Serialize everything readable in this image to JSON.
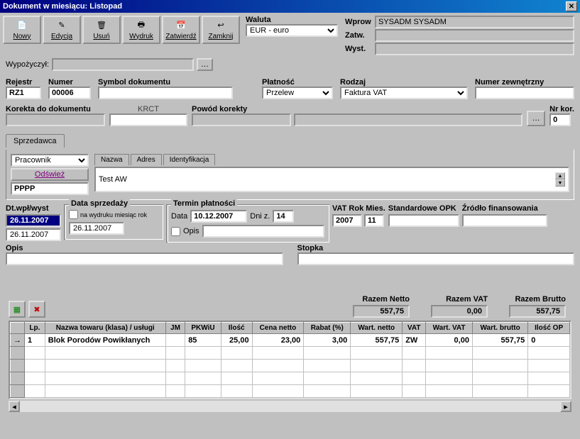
{
  "title": "Dokument w miesiącu: Listopad",
  "toolbar": {
    "nowy": "Nowy",
    "edycja": "Edycja",
    "usun": "Usuń",
    "wydruk": "Wydruk",
    "zatwierdz": "Zatwierdź",
    "zamknij": "Zamknij"
  },
  "header": {
    "waluta_lbl": "Waluta",
    "waluta_val": "EUR - euro",
    "wprow_lbl": "Wprow",
    "wprow_val": "SYSADM SYSADM",
    "zatw_lbl": "Zatw.",
    "zatw_val": "",
    "wyst_lbl": "Wyst.",
    "wyst_val": "",
    "wypozyczyl_lbl": "Wypożyczył:",
    "wypozyczyl_val": ""
  },
  "doc": {
    "rejestr_lbl": "Rejestr",
    "rejestr_val": "RZ1",
    "numer_lbl": "Numer",
    "numer_val": "00006",
    "symbol_lbl": "Symbol dokumentu",
    "symbol_val": "",
    "platnosc_lbl": "Płatność",
    "platnosc_val": "Przelew",
    "rodzaj_lbl": "Rodzaj",
    "rodzaj_val": "Faktura VAT",
    "numer_zew_lbl": "Numer zewnętrzny",
    "numer_zew_val": "",
    "korekta_lbl": "Korekta do dokumentu",
    "korekta_mid": "KRCT",
    "powod_lbl": "Powód korekty",
    "nrkor_lbl": "Nr kor.",
    "nrkor_val": "0"
  },
  "sprzedawca": {
    "tab": "Sprzedawca",
    "typ_val": "Pracownik",
    "sub_nazwa": "Nazwa",
    "sub_adres": "Adres",
    "sub_ident": "Identyfikacja",
    "odswiez": "Odśwież",
    "kod_val": "PPPP",
    "nazwa_val": "Test AW"
  },
  "dates": {
    "dt_wpl_lbl": "Dt.wpł/wyst",
    "dt_wpl_val": "26.11.2007",
    "dt_wpl2_val": "26.11.2007",
    "data_sprz_lbl": "Data sprzedaży",
    "na_wydruku_lbl": "na wydruku miesiąc rok",
    "data_sprz_val": "26.11.2007",
    "termin_lbl": "Termin płatności",
    "data_lbl": "Data",
    "data_val": "10.12.2007",
    "dni_lbl": "Dni z.",
    "dni_val": "14",
    "opis_chk_lbl": "Opis",
    "vat_rok_lbl": "VAT Rok Mies.",
    "vat_rok_val": "2007",
    "vat_mies_val": "11",
    "std_opk_lbl": "Standardowe OPK",
    "std_opk_val": "",
    "zrodlo_lbl": "Źródło finansowania",
    "zrodlo_val": ""
  },
  "opis": {
    "opis_lbl": "Opis",
    "opis_val": "",
    "stopka_lbl": "Stopka",
    "stopka_val": ""
  },
  "totals": {
    "netto_lbl": "Razem Netto",
    "netto_val": "557,75",
    "vat_lbl": "Razem VAT",
    "vat_val": "0,00",
    "brutto_lbl": "Razem Brutto",
    "brutto_val": "557,75"
  },
  "grid": {
    "headers": [
      "Lp.",
      "Nazwa towaru (klasa) / usługi",
      "JM",
      "PKWiU",
      "Ilość",
      "Cena netto",
      "Rabat (%)",
      "Wart. netto",
      "VAT",
      "Wart. VAT",
      "Wart. brutto",
      "Ilość OP"
    ],
    "rows": [
      {
        "lp": "1",
        "nazwa": "Blok Porodów Powikłanych",
        "jm": "",
        "pkwiu": "85",
        "ilosc": "25,00",
        "cena": "23,00",
        "rabat": "3,00",
        "wnetto": "557,75",
        "vat": "ZW",
        "wvat": "0,00",
        "wbrutto": "557,75",
        "iop": "0"
      }
    ]
  }
}
